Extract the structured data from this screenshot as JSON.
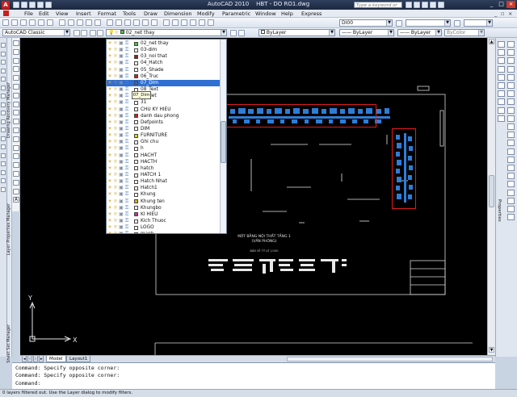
{
  "titlebar": {
    "app": "AutoCAD 2010",
    "file": "HBT - DO RO1.dwg",
    "search_placeholder": "Type a keyword or phrase",
    "app_icon_label": "A",
    "minimize": "_",
    "maximize": "□",
    "close": "×"
  },
  "menu": [
    "File",
    "Edit",
    "View",
    "Insert",
    "Format",
    "Tools",
    "Draw",
    "Dimension",
    "Modify",
    "Parametric",
    "Window",
    "Help",
    "Express"
  ],
  "toolbar1": {
    "dimstyle": "DI00",
    "icon_names": [
      "new-icon",
      "open-icon",
      "save-icon",
      "print-icon",
      "preview-icon",
      "publish-icon",
      "cut-icon",
      "copy-icon",
      "paste-icon",
      "match-icon",
      "undo-icon",
      "redo-icon",
      "pan-icon",
      "zoom-icon",
      "zoom-window-icon",
      "zoom-prev-icon",
      "properties-icon",
      "design-center-icon",
      "tool-palettes-icon",
      "sheetset-icon",
      "markup-icon",
      "calc-icon",
      "help-icon"
    ]
  },
  "toolbar2": {
    "workspace": "AutoCAD Classic",
    "current_layer": "02_net thay",
    "color": "ByLayer",
    "linetype": "ByLayer",
    "lineweight": "ByLayer",
    "plotstyle": "ByColor"
  },
  "palettes": {
    "drawing_recovery": "Drawing Recovery Manager",
    "layer_properties": "Layer Properties Manager",
    "sheet_set": "Sheet Set Manager",
    "properties": "Properties"
  },
  "layers": {
    "highlighted": "07_Dim",
    "tooltip": "07_Dim",
    "items": [
      {
        "name": "02_net thay",
        "color": "#3dcc3d"
      },
      {
        "name": "03-dim",
        "color": "#ffffff"
      },
      {
        "name": "03_noi that",
        "color": "#9b1c1c"
      },
      {
        "name": "04_Hatch",
        "color": "#ffffff"
      },
      {
        "name": "05_Shade",
        "color": "#ffffff"
      },
      {
        "name": "06_Truc",
        "color": "#cc1f1f"
      },
      {
        "name": "07_Dim",
        "color": "#2a6bd6"
      },
      {
        "name": "08_Text",
        "color": "#ffffff"
      },
      {
        "name": "12-Net",
        "color": "#ffffff"
      },
      {
        "name": "31",
        "color": "#ffffff"
      },
      {
        "name": "CHU KY HIEU",
        "color": "#ffffff"
      },
      {
        "name": "danh dau phong",
        "color": "#cc1f1f"
      },
      {
        "name": "Defpoints",
        "color": "#ffffff"
      },
      {
        "name": "DIM",
        "color": "#ffffff"
      },
      {
        "name": "FURNITURE",
        "color": "#d9d916"
      },
      {
        "name": "Ghi chu",
        "color": "#ffffff"
      },
      {
        "name": "h",
        "color": "#ffffff"
      },
      {
        "name": "HACHT",
        "color": "#ffffff"
      },
      {
        "name": "HACTH",
        "color": "#ffffff"
      },
      {
        "name": "hatch",
        "color": "#ffffff"
      },
      {
        "name": "HATCH 1",
        "color": "#ffffff"
      },
      {
        "name": "Hatch Nhat",
        "color": "#ffffff"
      },
      {
        "name": "Hatch1",
        "color": "#ffffff"
      },
      {
        "name": "Khung",
        "color": "#ffffff"
      },
      {
        "name": "Khung ten",
        "color": "#d8b817"
      },
      {
        "name": "Khungbo",
        "color": "#ffffff"
      },
      {
        "name": "KI HIEU",
        "color": "#d0309c"
      },
      {
        "name": "Kich Thuoc",
        "color": "#ffffff"
      },
      {
        "name": "LOGO",
        "color": "#ffffff"
      },
      {
        "name": "manh",
        "color": "#ffffff"
      }
    ]
  },
  "drawing": {
    "title_line1": "MẶT BẰNG NỘI THẤT TẦNG 1",
    "title_line2": "(VĂN PHÒNG)",
    "scale_note": "BẢN VẼ TỶ LỆ 1/100",
    "ucs_x": "X",
    "ucs_y": "Y"
  },
  "tabs": [
    "Model",
    "Layout1"
  ],
  "command": {
    "lines": [
      "Command: Specify opposite corner:",
      "Command: Specify opposite corner:",
      "Command:"
    ]
  },
  "status": "0 layers filtered out.  Use the Layer dialog to modify filters."
}
